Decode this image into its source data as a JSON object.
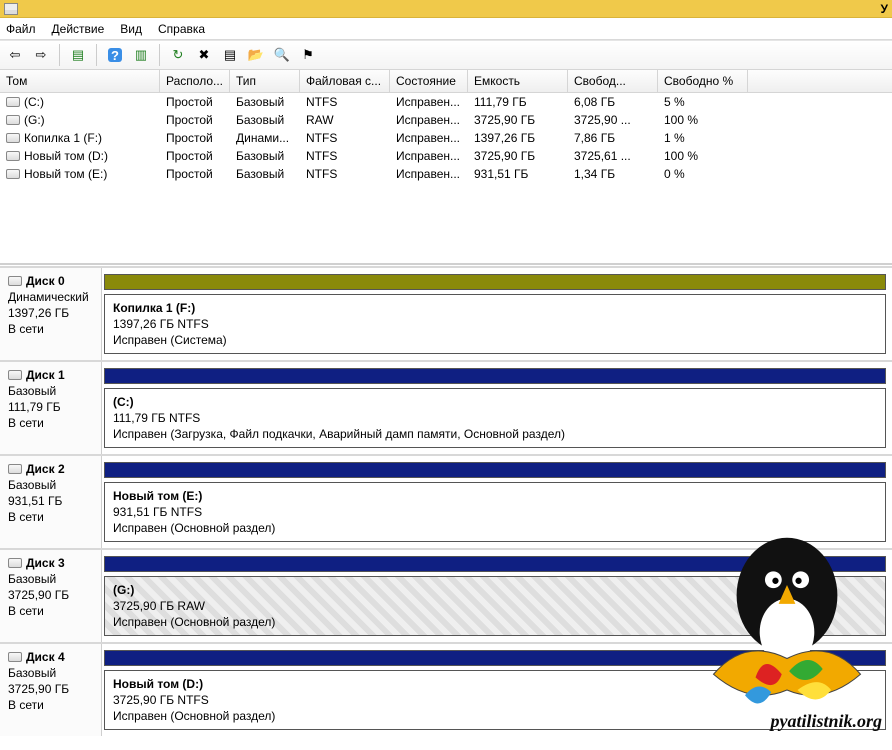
{
  "titlebar": {
    "caption_right": "У"
  },
  "menu": {
    "file": "Файл",
    "action": "Действие",
    "view": "Вид",
    "help": "Справка"
  },
  "toolbar_icons": {
    "back": "⇦",
    "forward": "⇨",
    "list_view": "▤",
    "help": "?",
    "panels": "▥",
    "refresh": "↻",
    "delete": "✖",
    "properties": "▤",
    "open_folder": "📂",
    "find": "🔍",
    "commit": "⚑"
  },
  "columns": {
    "volume": "Том",
    "layout": "Располо...",
    "type": "Тип",
    "filesystem": "Файловая с...",
    "status": "Состояние",
    "capacity": "Емкость",
    "free": "Свобод...",
    "free_pct": "Свободно %"
  },
  "volumes": [
    {
      "name": "(C:)",
      "layout": "Простой",
      "type": "Базовый",
      "fs": "NTFS",
      "status": "Исправен...",
      "capacity": "111,79 ГБ",
      "free": "6,08 ГБ",
      "pct": "5 %"
    },
    {
      "name": "(G:)",
      "layout": "Простой",
      "type": "Базовый",
      "fs": "RAW",
      "status": "Исправен...",
      "capacity": "3725,90 ГБ",
      "free": "3725,90 ...",
      "pct": "100 %"
    },
    {
      "name": "Копилка 1 (F:)",
      "layout": "Простой",
      "type": "Динами...",
      "fs": "NTFS",
      "status": "Исправен...",
      "capacity": "1397,26 ГБ",
      "free": "7,86 ГБ",
      "pct": "1 %"
    },
    {
      "name": "Новый том (D:)",
      "layout": "Простой",
      "type": "Базовый",
      "fs": "NTFS",
      "status": "Исправен...",
      "capacity": "3725,90 ГБ",
      "free": "3725,61 ...",
      "pct": "100 %"
    },
    {
      "name": "Новый том (E:)",
      "layout": "Простой",
      "type": "Базовый",
      "fs": "NTFS",
      "status": "Исправен...",
      "capacity": "931,51 ГБ",
      "free": "1,34 ГБ",
      "pct": "0 %"
    }
  ],
  "disks": [
    {
      "label": "Диск 0",
      "type": "Динамический",
      "size": "1397,26 ГБ",
      "state": "В сети",
      "stripe": "olive",
      "part_title": "Копилка 1  (F:)",
      "part_size": "1397,26 ГБ NTFS",
      "part_status": "Исправен (Система)",
      "hatched": false
    },
    {
      "label": "Диск 1",
      "type": "Базовый",
      "size": "111,79 ГБ",
      "state": "В сети",
      "stripe": "navy",
      "part_title": "(C:)",
      "part_size": "111,79 ГБ NTFS",
      "part_status": "Исправен (Загрузка, Файл подкачки, Аварийный дамп памяти, Основной раздел)",
      "hatched": false
    },
    {
      "label": "Диск 2",
      "type": "Базовый",
      "size": "931,51 ГБ",
      "state": "В сети",
      "stripe": "navy",
      "part_title": "Новый том  (E:)",
      "part_size": "931,51 ГБ NTFS",
      "part_status": "Исправен (Основной раздел)",
      "hatched": false
    },
    {
      "label": "Диск 3",
      "type": "Базовый",
      "size": "3725,90 ГБ",
      "state": "В сети",
      "stripe": "navy",
      "part_title": "(G:)",
      "part_size": "3725,90 ГБ RAW",
      "part_status": "Исправен (Основной раздел)",
      "hatched": true
    },
    {
      "label": "Диск 4",
      "type": "Базовый",
      "size": "3725,90 ГБ",
      "state": "В сети",
      "stripe": "navy",
      "part_title": "Новый том  (D:)",
      "part_size": "3725,90 ГБ NTFS",
      "part_status": "Исправен (Основной раздел)",
      "hatched": false
    }
  ],
  "watermark_text": "pyatilistnik.org"
}
